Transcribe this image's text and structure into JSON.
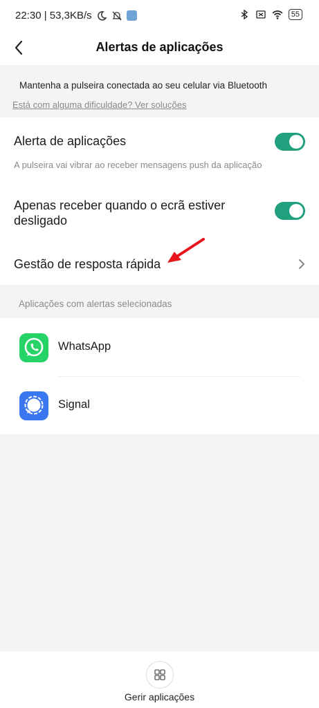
{
  "status_bar": {
    "time_speed": "22:30 | 53,3KB/s",
    "battery": "55"
  },
  "header": {
    "title": "Alertas de aplicações"
  },
  "info": {
    "message": "Mantenha a pulseira conectada ao seu celular via Bluetooth",
    "help_link": "Está com alguma dificuldade? Ver soluções"
  },
  "settings": {
    "app_alert": {
      "label": "Alerta de aplicações",
      "description": "A pulseira vai vibrar ao receber mensagens push da aplicação",
      "enabled": true
    },
    "screen_off_only": {
      "label": "Apenas receber quando o ecrã estiver desligado",
      "enabled": true
    },
    "quick_reply": {
      "label": "Gestão de resposta rápida"
    }
  },
  "apps_section": {
    "label": "Aplicações com alertas selecionadas",
    "apps": [
      {
        "name": "WhatsApp",
        "icon": "whatsapp-icon",
        "color": "#25D366"
      },
      {
        "name": "Signal",
        "icon": "signal-icon",
        "color": "#3a76f0"
      }
    ]
  },
  "bottom": {
    "manage_label": "Gerir aplicações"
  },
  "colors": {
    "toggle_on": "#20a07c",
    "annotation_arrow": "#e8141c"
  }
}
